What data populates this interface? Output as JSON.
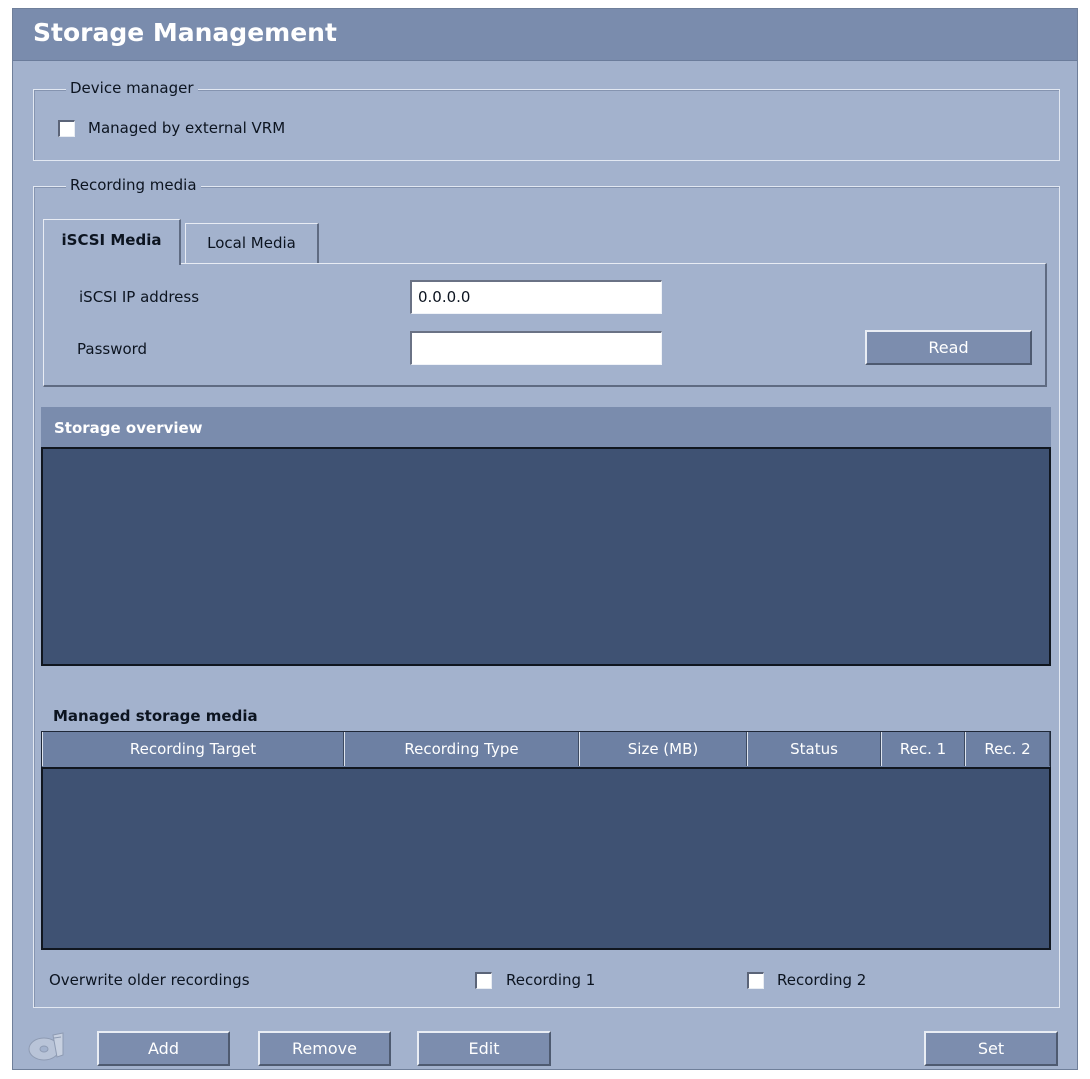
{
  "header": {
    "title": "Storage Management"
  },
  "device_manager": {
    "legend": "Device manager",
    "managed_external_vrm": {
      "label": "Managed by external VRM",
      "checked": false
    }
  },
  "recording_media": {
    "legend": "Recording media",
    "tabs": [
      {
        "label": "iSCSI Media",
        "active": true
      },
      {
        "label": "Local Media",
        "active": false
      }
    ],
    "iscsi": {
      "ip_label": "iSCSI IP address",
      "ip_value": "0.0.0.0",
      "password_label": "Password",
      "password_value": "",
      "read_button": "Read"
    }
  },
  "storage_overview": {
    "title": "Storage overview"
  },
  "managed_storage": {
    "title": "Managed storage media",
    "columns": [
      "Recording Target",
      "Recording Type",
      "Size (MB)",
      "Status",
      "Rec. 1",
      "Rec. 2"
    ],
    "rows": []
  },
  "overwrite": {
    "label": "Overwrite older recordings",
    "recording1": {
      "label": "Recording 1",
      "checked": false
    },
    "recording2": {
      "label": "Recording 2",
      "checked": false
    }
  },
  "footer": {
    "add_button": "Add",
    "remove_button": "Remove",
    "edit_button": "Edit",
    "set_button": "Set",
    "icon": "cd-disc-icon"
  },
  "colors": {
    "background": "#a3b2cd",
    "title_bar": "#7a8cad",
    "dark_panel": "#3f5273",
    "button": "#7c8dae"
  }
}
